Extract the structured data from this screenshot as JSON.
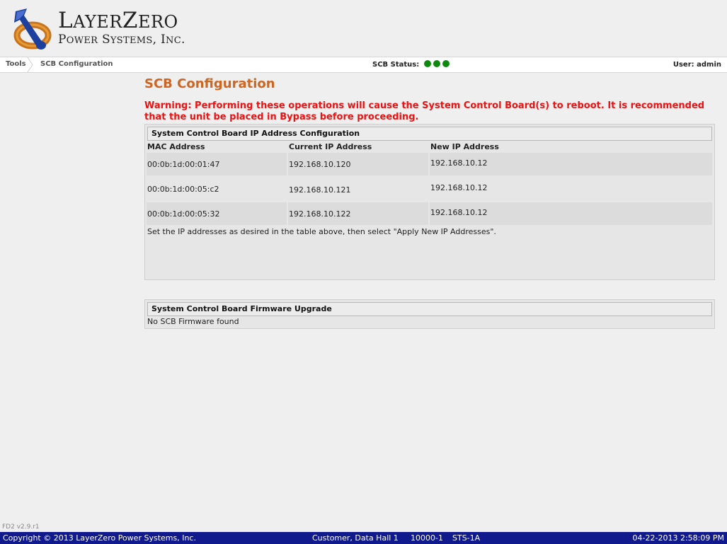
{
  "brand": {
    "line1_big": "L",
    "line1_small": "AYER",
    "line1_big2": "Z",
    "line1_small2": "ERO",
    "line2_big": "P",
    "line2_small": "OWER",
    "line2_big2": "S",
    "line2_small2": "YSTEMS",
    "line2_tail": ", I",
    "line2_small3": "NC",
    "line2_dot": "."
  },
  "nav": {
    "crumbs": [
      "Tools",
      "SCB Configuration"
    ],
    "scb_status_label": "SCB Status:",
    "status_colors": [
      "#0d8a0d",
      "#0d8a0d",
      "#0d8a0d"
    ],
    "user": "User: admin"
  },
  "page": {
    "title": "SCB Configuration",
    "warning": "Warning: Performing these operations will cause the System Control Board(s) to reboot. It is recommended that the unit be placed in Bypass before proceeding."
  },
  "ip_config": {
    "heading": "System Control Board IP Address Configuration",
    "columns": [
      "MAC Address",
      "Current IP Address",
      "New IP Address"
    ],
    "rows": [
      {
        "mac": "00:0b:1d:00:01:47",
        "current_ip": "192.168.10.120",
        "new_ip": "192.168.10.12"
      },
      {
        "mac": "00:0b:1d:00:05:c2",
        "current_ip": "192.168.10.121",
        "new_ip": "192.168.10.12"
      },
      {
        "mac": "00:0b:1d:00:05:32",
        "current_ip": "192.168.10.122",
        "new_ip": "192.168.10.12"
      }
    ],
    "note": "Set the IP addresses as desired in the table above, then select \"Apply New IP Addresses\"."
  },
  "firmware": {
    "heading": "System Control Board Firmware Upgrade",
    "status": "No SCB Firmware found"
  },
  "footer": {
    "version": "FD2 v2.9.r1",
    "copyright": "Copyright © 2013 LayerZero Power Systems, Inc.",
    "customer": "Customer, Data Hall 1",
    "unit": "10000-1",
    "model": "STS-1A",
    "datetime": "04-22-2013 2:58:09 PM"
  }
}
